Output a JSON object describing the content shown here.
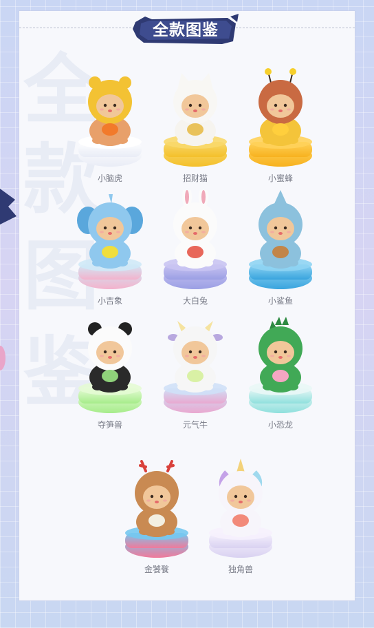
{
  "header": {
    "title": "全款图鉴"
  },
  "figures": [
    {
      "name": "小脑虎",
      "hood": "#f3c233",
      "hoodAccent": "#5a3b26",
      "ears": "tiger",
      "body": "#e8a06a",
      "base": "#e9ecf6",
      "base2": "#ffffff",
      "prop": "#f27a2b"
    },
    {
      "name": "招财猫",
      "hood": "#f8f7f4",
      "hoodAccent": "#e2524a",
      "ears": "cat",
      "body": "#f6f4ef",
      "base": "#f4c02b",
      "base2": "#f8d86a",
      "prop": "#e9c25a"
    },
    {
      "name": "小蜜蜂",
      "hood": "#c96a42",
      "hoodAccent": "#f6cf2c",
      "ears": "bee",
      "body": "#f4c43a",
      "base": "#f7b21f",
      "base2": "#ffd25a",
      "prop": "#ffcf3d"
    },
    {
      "name": "小吉象",
      "hood": "#8fc8ee",
      "hoodAccent": "#5aa7dc",
      "ears": "elephant",
      "body": "#8fc8ee",
      "base": "#f3b2cc",
      "base2": "#cfe9f7",
      "prop": "#f0de3e"
    },
    {
      "name": "大白兔",
      "hood": "#fbfbfb",
      "hoodAccent": "#f0a9b9",
      "ears": "rabbit",
      "body": "#fbfbfb",
      "base": "#9b9fe4",
      "base2": "#c9c4f2",
      "prop": "#e8675a"
    },
    {
      "name": "小鲨鱼",
      "hood": "#8cc1dd",
      "hoodAccent": "#ffffff",
      "ears": "shark",
      "body": "#8cc1dd",
      "base": "#39a4de",
      "base2": "#8fd4f3",
      "prop": "#c28549"
    },
    {
      "name": "夺笋兽",
      "hood": "#fbfbfb",
      "hoodAccent": "#222222",
      "ears": "panda",
      "body": "#2a2a2a",
      "base": "#a6ec8a",
      "base2": "#e4fbd4",
      "prop": "#8fd27a"
    },
    {
      "name": "元气牛",
      "hood": "#f6f6f6",
      "hoodAccent": "#b8a8df",
      "ears": "cow",
      "body": "#f6f6f6",
      "base": "#e9a8d0",
      "base2": "#cfe0f7",
      "prop": "#d9f1a5"
    },
    {
      "name": "小恐龙",
      "hood": "#41a956",
      "hoodAccent": "#2e8a42",
      "ears": "dino",
      "body": "#41a956",
      "base": "#8fe0dd",
      "base2": "#e9f7f6",
      "prop": "#f4a6c2"
    },
    {
      "name": "金饕餮",
      "hood": "#c98a52",
      "hoodAccent": "#d9403a",
      "ears": "dragon",
      "body": "#c98a52",
      "base": "#f07a9b",
      "base2": "#75c8f0",
      "prop": "#f3efe2"
    },
    {
      "name": "独角兽",
      "hood": "#f7f5fb",
      "hoodAccent": "#c4a2e8",
      "ears": "unicorn",
      "body": "#f7f5fb",
      "base": "#d9d2f1",
      "base2": "#f6f1fd",
      "prop": "#f28a7a"
    }
  ]
}
